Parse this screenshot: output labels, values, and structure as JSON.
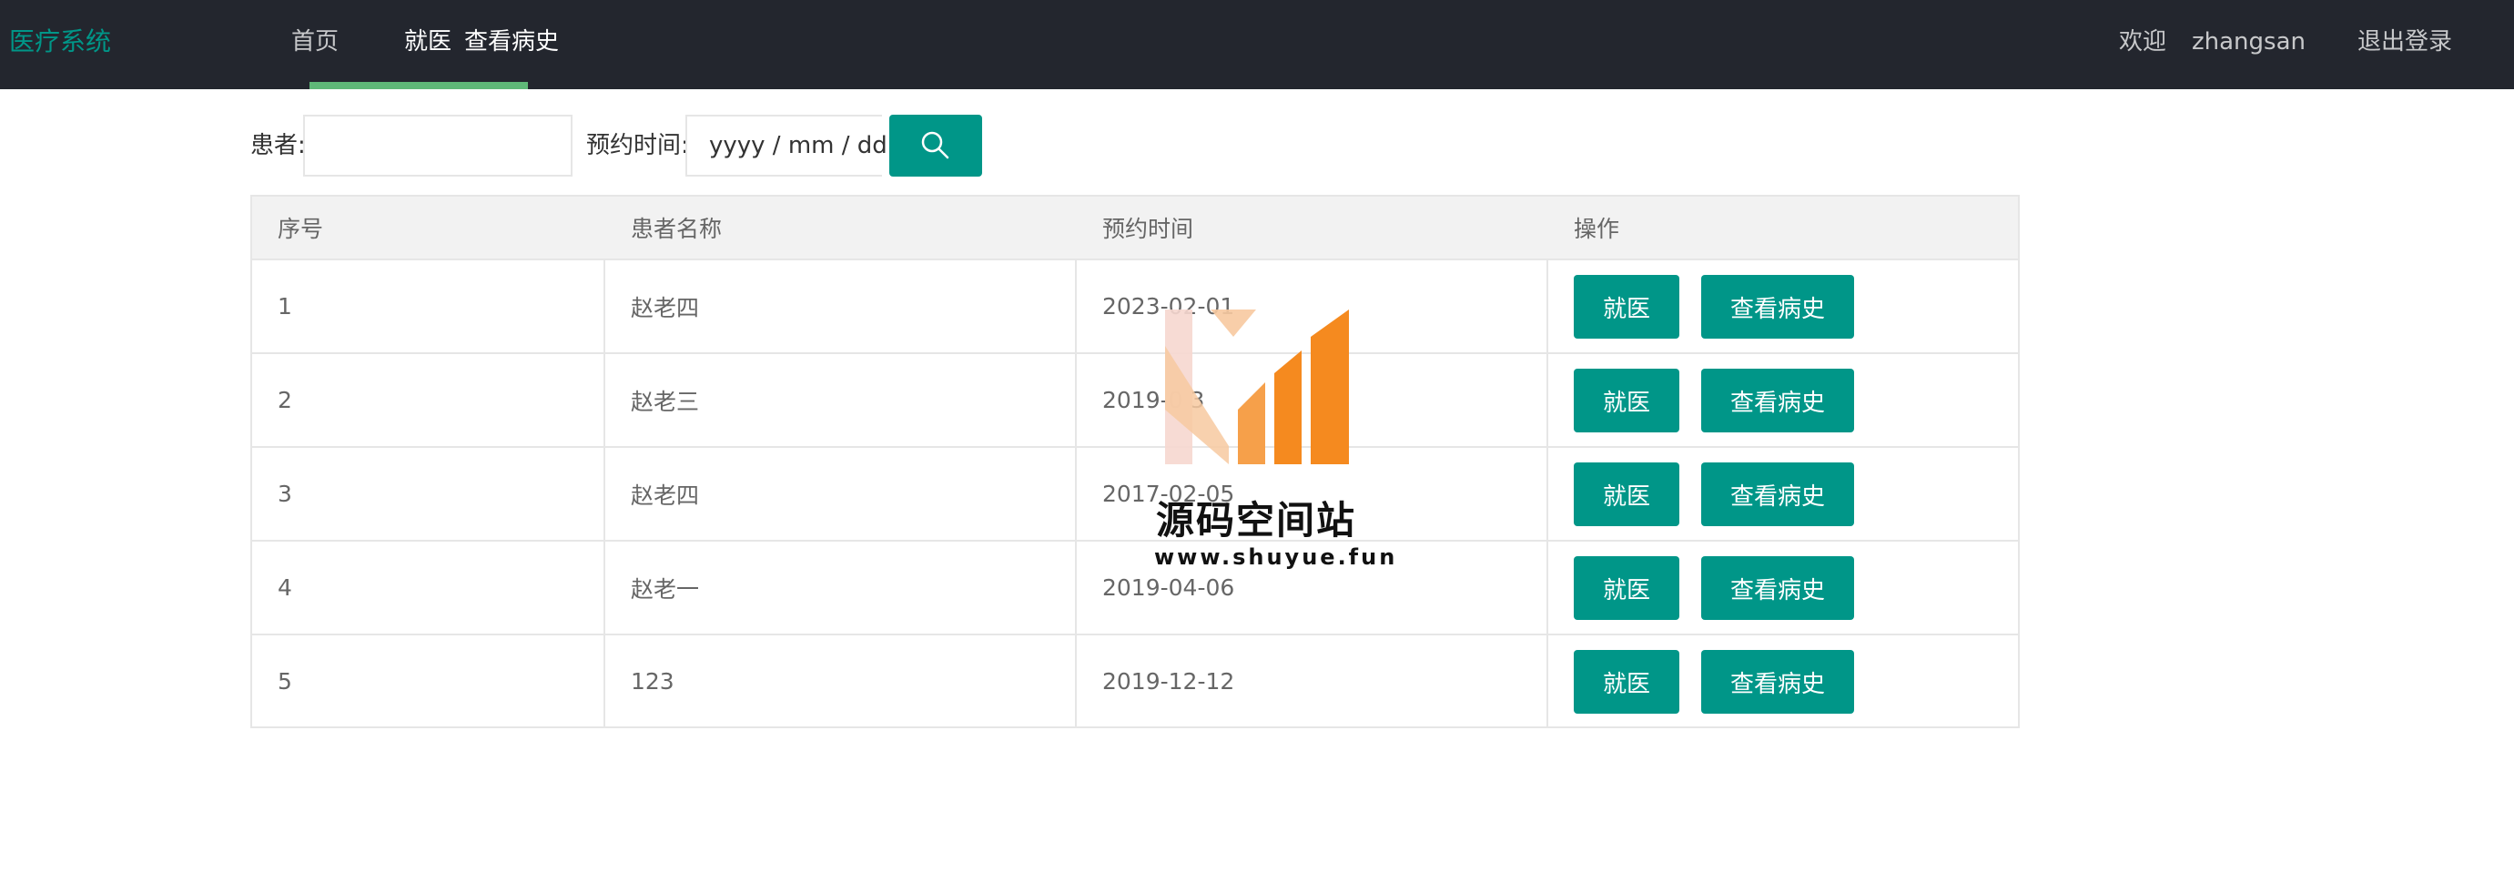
{
  "header": {
    "brand": "医疗系统",
    "nav": [
      {
        "label": "首页"
      },
      {
        "label": "就医"
      },
      {
        "label": "查看病史"
      }
    ],
    "welcome": "欢迎",
    "username": "zhangsan",
    "logout": "退出登录"
  },
  "search": {
    "patient_label": "患者:",
    "patient_value": "",
    "time_label": "预约时间:",
    "date_placeholder": "yyyy / mm / dd",
    "search_icon": "search-icon"
  },
  "table": {
    "columns": [
      "序号",
      "患者名称",
      "预约时间",
      "操作"
    ],
    "rows": [
      {
        "no": "1",
        "name": "赵老四",
        "time": "2023-02-01"
      },
      {
        "no": "2",
        "name": "赵老三",
        "time": "2019-0  3"
      },
      {
        "no": "3",
        "name": "赵老四",
        "time": "2017-02-05"
      },
      {
        "no": "4",
        "name": "赵老一",
        "time": "2019-04-06"
      },
      {
        "no": "5",
        "name": "123",
        "time": "2019-12-12"
      }
    ],
    "actions": {
      "visit": "就医",
      "history": "查看病史"
    }
  },
  "watermark": {
    "title": "源码空间站",
    "url": "www.shuyue.fun"
  },
  "colors": {
    "topbar": "#23262e",
    "accent": "#009688",
    "nav_underline": "#5fb878"
  }
}
